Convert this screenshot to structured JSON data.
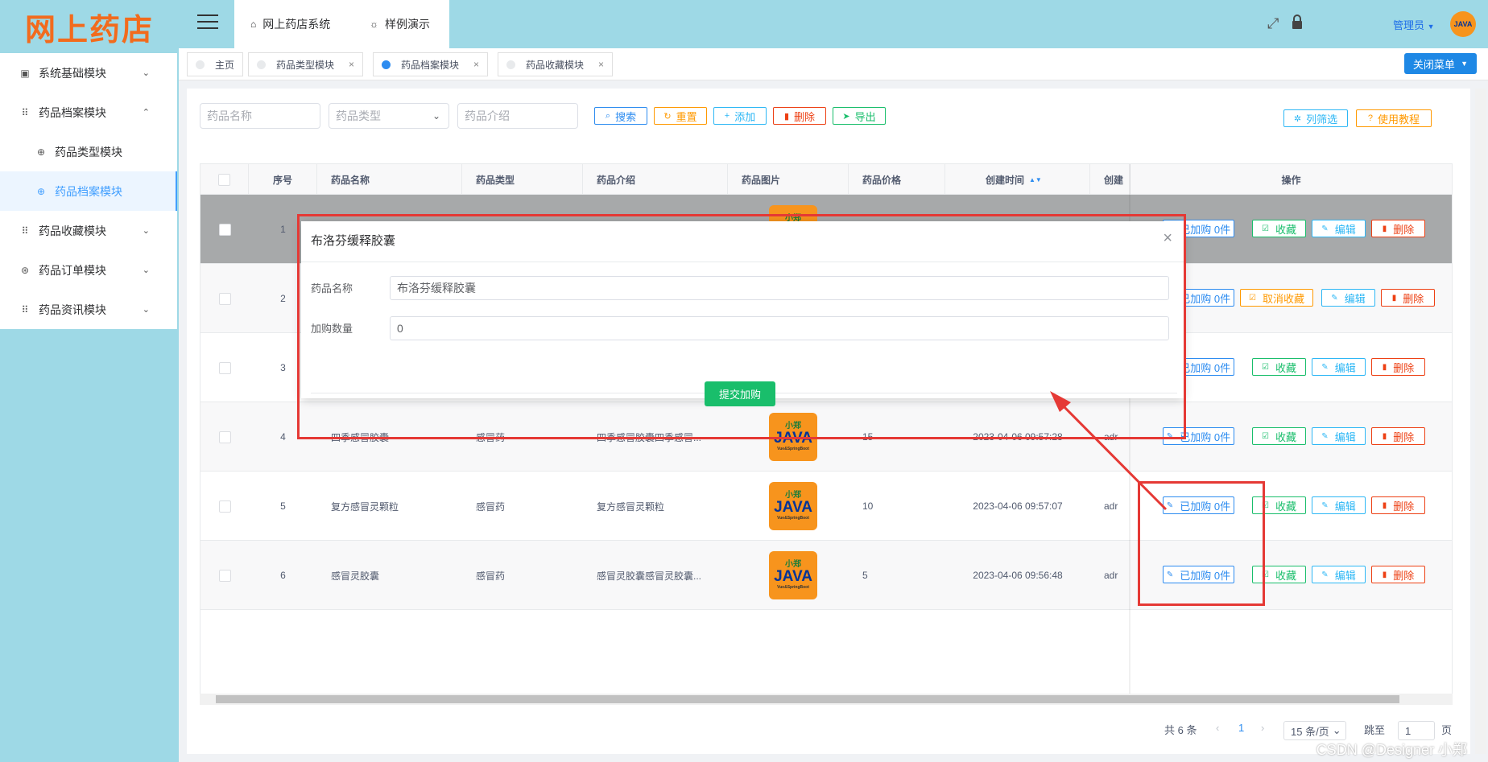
{
  "app": {
    "logo": "网上药店"
  },
  "sidebar": {
    "items": [
      {
        "label": "系统基础模块",
        "icon": "chart-icon",
        "arrow": "⌄"
      },
      {
        "label": "药品档案模块",
        "icon": "grid-icon",
        "arrow": "⌃"
      },
      {
        "label": "药品类型模块",
        "icon": "circle-icon"
      },
      {
        "label": "药品档案模块",
        "icon": "circle-icon"
      },
      {
        "label": "药品收藏模块",
        "icon": "grid-icon",
        "arrow": "⌄"
      },
      {
        "label": "药品订单模块",
        "icon": "circle-icon",
        "arrow": "⌄"
      },
      {
        "label": "药品资讯模块",
        "icon": "grid-icon",
        "arrow": "⌄"
      }
    ]
  },
  "header": {
    "nav": [
      {
        "label": "网上药店系统",
        "icon": "home-icon"
      },
      {
        "label": "样例演示",
        "icon": "bulb-icon"
      }
    ],
    "user": "管理员",
    "avatar_text": "JAVA"
  },
  "tags": [
    {
      "label": "主页"
    },
    {
      "label": "药品类型模块",
      "close": "×"
    },
    {
      "label": "药品档案模块",
      "close": "×"
    },
    {
      "label": "药品收藏模块",
      "close": "×"
    }
  ],
  "close_menu": "关闭菜单",
  "filters": {
    "name_placeholder": "药品名称",
    "type_placeholder": "药品类型",
    "intro_placeholder": "药品介绍"
  },
  "toolbar": {
    "search": "搜索",
    "reset": "重置",
    "add": "添加",
    "delete": "删除",
    "export": "导出",
    "column_filter": "列筛选",
    "tutorial": "使用教程"
  },
  "table": {
    "headers": [
      "序号",
      "药品名称",
      "药品类型",
      "药品介绍",
      "药品图片",
      "药品价格",
      "创建时间",
      "创建",
      "操作"
    ],
    "rows": [
      {
        "no": "1",
        "name": "",
        "type": "",
        "intro": "",
        "price": "",
        "time": "",
        "creator": "",
        "cart": "已加购 0件",
        "fav": "收藏"
      },
      {
        "no": "2",
        "name": "",
        "type": "",
        "intro": "",
        "price": "",
        "time": "",
        "creator": "",
        "cart": "已加购 0件",
        "fav": "取消收藏"
      },
      {
        "no": "3",
        "name": "",
        "type": "",
        "intro": "",
        "price": "",
        "time": "",
        "creator": "",
        "cart": "已加购 0件",
        "fav": "收藏"
      },
      {
        "no": "4",
        "name": "四季感冒胶囊",
        "type": "感冒药",
        "intro": "四季感冒胶囊四季感冒...",
        "price": "15",
        "time": "2023-04-06 09:57:28",
        "creator": "adr",
        "cart": "已加购 0件",
        "fav": "收藏"
      },
      {
        "no": "5",
        "name": "复方感冒灵颗粒",
        "type": "感冒药",
        "intro": "复方感冒灵颗粒",
        "price": "10",
        "time": "2023-04-06 09:57:07",
        "creator": "adr",
        "cart": "已加购 0件",
        "fav": "收藏"
      },
      {
        "no": "6",
        "name": "感冒灵胶囊",
        "type": "感冒药",
        "intro": "感冒灵胶囊感冒灵胶囊...",
        "price": "5",
        "time": "2023-04-06 09:56:48",
        "creator": "adr",
        "cart": "已加购 0件",
        "fav": "收藏"
      }
    ],
    "edit": "编辑",
    "del": "删除",
    "thumb_top": "小郑",
    "thumb_mid": "JAVA",
    "thumb_bot": "Vue&SpringBoot"
  },
  "pagination": {
    "total": "共 6 条",
    "current": "1",
    "size": "15 条/页",
    "jump": "跳至",
    "jump_value": "1",
    "page_unit": "页"
  },
  "dialog": {
    "title": "布洛芬缓释胶囊",
    "name_label": "药品名称",
    "name_value": "布洛芬缓释胶囊",
    "qty_label": "加购数量",
    "qty_value": "0",
    "submit": "提交加购"
  },
  "watermark": "CSDN @Designer 小郑"
}
